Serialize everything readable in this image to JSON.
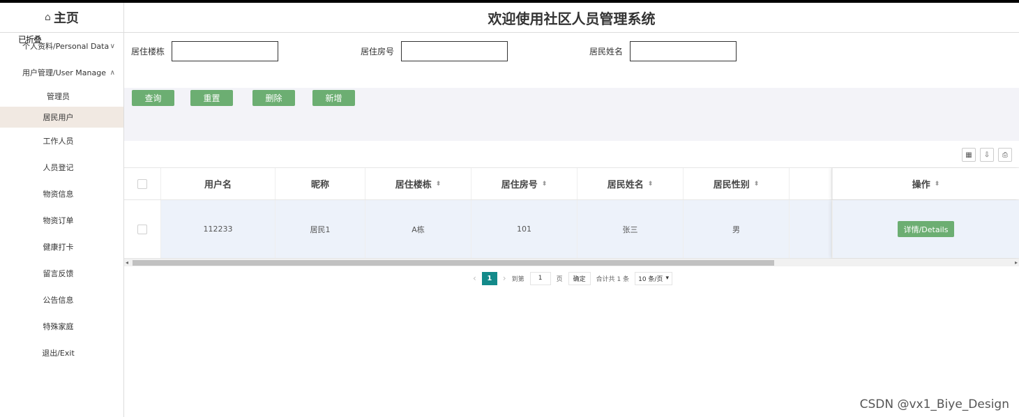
{
  "sidebar": {
    "home_label": "主页",
    "overlay_tip": "已折叠",
    "groups": [
      {
        "label": "个人资料/Personal Data",
        "chevron": "∨"
      },
      {
        "label": "用户管理/User Manage",
        "chevron": "∧"
      }
    ],
    "items": [
      "管理员",
      "居民用户",
      "工作人员",
      "人员登记",
      "物资信息",
      "物资订单",
      "健康打卡",
      "留言反馈",
      "公告信息",
      "特殊家庭",
      "退出/Exit"
    ],
    "active_item": "居民用户"
  },
  "header": {
    "title": "欢迎使用社区人员管理系统"
  },
  "filters": [
    {
      "label": "居住楼栋",
      "value": ""
    },
    {
      "label": "居住房号",
      "value": ""
    },
    {
      "label": "居民姓名",
      "value": ""
    }
  ],
  "buttons": {
    "query": "查询",
    "reset": "重置",
    "delete": "删除",
    "add": "新增"
  },
  "toolbar_icons": [
    "grid-icon",
    "export-icon",
    "print-icon"
  ],
  "table": {
    "columns": [
      "用户名",
      "昵称",
      "居住楼栋",
      "居住房号",
      "居民姓名",
      "居民性别",
      "",
      "操作"
    ],
    "rows": [
      {
        "username": "112233",
        "nickname": "居民1",
        "building": "A栋",
        "room": "101",
        "name": "张三",
        "gender": "男",
        "action": "详情/Details"
      }
    ]
  },
  "pagination": {
    "current_page": "1",
    "goto_label": "到第",
    "goto_value": "1",
    "page_unit": "页",
    "confirm": "确定",
    "total": "合计共 1 条",
    "page_size": "10 条/页"
  },
  "watermark": "CSDN @vx1_Biye_Design",
  "colors": {
    "accent_green": "#6cae72",
    "pager_active": "#138a8a",
    "row_bg": "#edf2fa",
    "active_nav": "#f1e9e2"
  }
}
